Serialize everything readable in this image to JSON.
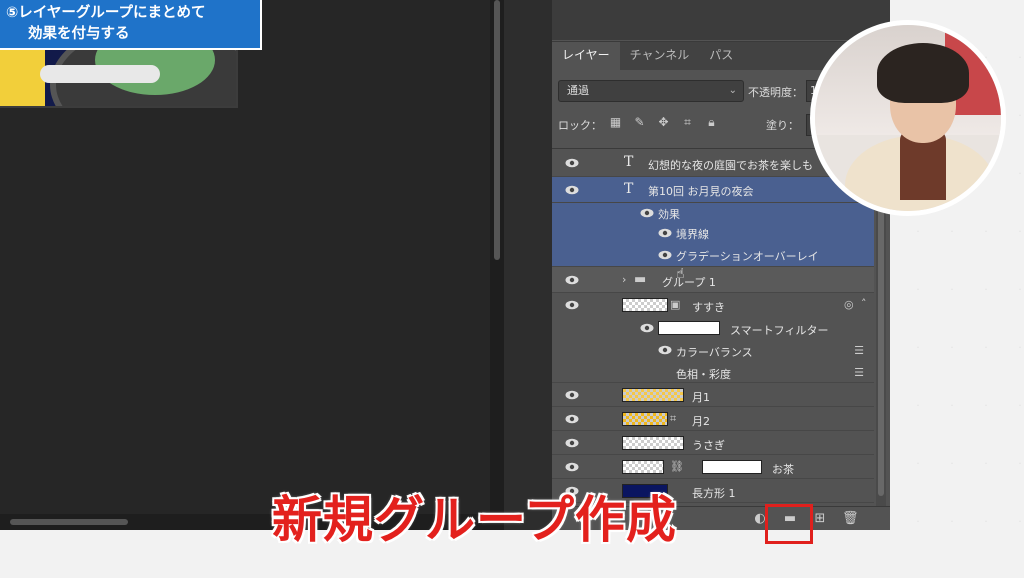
{
  "step_caption": {
    "line1": "⑤レイヤーグループにまとめて",
    "line2": "効果を付与する"
  },
  "big_caption": "新規グループ作成",
  "panel": {
    "tabs": [
      {
        "label": "レイヤー",
        "active": true
      },
      {
        "label": "チャンネル",
        "active": false
      },
      {
        "label": "パス",
        "active": false
      }
    ],
    "blend_mode": "通過",
    "opacity_label": "不透明度：",
    "opacity_value": "1",
    "lock_label": "ロック：",
    "fill_label": "塗り：",
    "fill_value": "1"
  },
  "layers": [
    {
      "name": "幻想的な夜の庭園でお茶を楽しも",
      "kind": "text"
    },
    {
      "name": "第10回 お月見の夜会",
      "kind": "text",
      "selected": true
    },
    {
      "name": "効果",
      "kind": "effects",
      "selected": true
    },
    {
      "name": "境界線",
      "kind": "effect",
      "selected": true
    },
    {
      "name": "グラデーションオーバーレイ",
      "kind": "effect",
      "selected": true
    },
    {
      "name": "グループ 1",
      "kind": "group"
    },
    {
      "name": "すすき",
      "kind": "smart"
    },
    {
      "name": "スマートフィルター",
      "kind": "smart-filter"
    },
    {
      "name": "カラーバランス",
      "kind": "filter"
    },
    {
      "name": "色相・彩度",
      "kind": "filter"
    },
    {
      "name": "月1",
      "kind": "image"
    },
    {
      "name": "月2",
      "kind": "image"
    },
    {
      "name": "うさぎ",
      "kind": "image"
    },
    {
      "name": "お茶",
      "kind": "masked"
    },
    {
      "name": "長方形 1",
      "kind": "shape"
    }
  ],
  "colors": {
    "caption_red": "#e3211d",
    "step_blue": "#1f73c9",
    "selection_blue": "#4a6090",
    "panel_gray": "#535353"
  }
}
